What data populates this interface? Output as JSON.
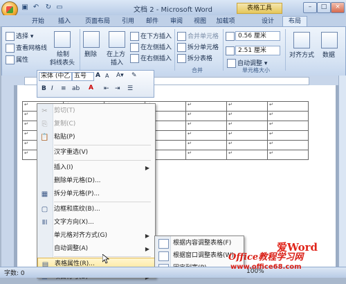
{
  "window": {
    "title": "文档 2 - Microsoft Word",
    "tools_title": "表格工具",
    "controls": [
      "–",
      "□",
      "×"
    ]
  },
  "quick_access": [
    "save-icon",
    "undo-icon",
    "redo-icon",
    "open-icon"
  ],
  "tabs": [
    "开始",
    "插入",
    "页面布局",
    "引用",
    "邮件",
    "审阅",
    "视图",
    "加载项",
    "设计",
    "布局"
  ],
  "active_tab": "布局",
  "ribbon": {
    "table_group": {
      "select": "选择",
      "gridlines": "查看网格线",
      "properties": "属性",
      "label": "表"
    },
    "draw_group": {
      "draw": "绘制",
      "draw2": "斜线表头"
    },
    "delete": "删除",
    "insert_above": "在上方",
    "insert_above2": "插入",
    "insert_below": "在下方插入",
    "insert_left": "在左侧插入",
    "insert_right": "在右侧插入",
    "merge_cells": "合并单元格",
    "split_cells": "拆分单元格",
    "split_table": "拆分表格",
    "merge_label": "合并",
    "height": "0.56 厘米",
    "width": "2.51 厘米",
    "autofit": "自动调整",
    "cellsize_label": "单元格大小",
    "align": "对齐方式",
    "data": "数据"
  },
  "mini_toolbar": {
    "font": "宋体 (中乙",
    "size": "五号",
    "bold": "B",
    "italic": "I",
    "align": "≡",
    "grow": "A",
    "shrink": "A"
  },
  "table": {
    "rows": 6,
    "cols": 7,
    "mark": "↵"
  },
  "context_menu": [
    {
      "label": "剪切(T)",
      "icon": "✂",
      "name": "cut",
      "disabled": true
    },
    {
      "label": "复制(C)",
      "icon": "⎘",
      "name": "copy",
      "disabled": true
    },
    {
      "label": "粘贴(P)",
      "icon": "📋",
      "name": "paste",
      "disabled": false
    },
    {
      "sep": true
    },
    {
      "label": "汉字重选(V)",
      "icon": "",
      "name": "reconvert",
      "disabled": false
    },
    {
      "sep": true
    },
    {
      "label": "插入(I)",
      "icon": "",
      "name": "insert",
      "disabled": false,
      "arrow": true
    },
    {
      "label": "删除单元格(D)...",
      "icon": "",
      "name": "delete-cells",
      "disabled": false
    },
    {
      "label": "拆分单元格(P)...",
      "icon": "▦",
      "name": "split-cells",
      "disabled": false
    },
    {
      "sep": true
    },
    {
      "label": "边框和底纹(B)...",
      "icon": "▢",
      "name": "borders",
      "disabled": false
    },
    {
      "label": "文字方向(X)...",
      "icon": "ⅡⅠ",
      "name": "text-direction",
      "disabled": false
    },
    {
      "label": "单元格对齐方式(G)",
      "icon": "",
      "name": "cell-align",
      "disabled": false,
      "arrow": true
    },
    {
      "label": "自动调整(A)",
      "icon": "",
      "name": "autofit",
      "disabled": false,
      "arrow": true
    },
    {
      "sep": true
    },
    {
      "label": "表格属性(R)...",
      "icon": "▤",
      "name": "table-properties",
      "disabled": false,
      "highlighted": true
    },
    {
      "label": "项目符号(B)",
      "icon": "☰",
      "name": "bullets",
      "disabled": false,
      "arrow": true
    }
  ],
  "submenu": [
    {
      "label": "根据内容调整表格(F)",
      "name": "autofit-contents"
    },
    {
      "label": "根据窗口调整表格(W)",
      "name": "autofit-window"
    },
    {
      "label": "固定列宽(P)",
      "name": "fixed-width"
    }
  ],
  "status": {
    "words": "字数: 0",
    "zoom": "100%"
  },
  "watermark": {
    "line1": "爱Word",
    "line2": "Office教程学习网",
    "line3": "www.office68.com"
  }
}
